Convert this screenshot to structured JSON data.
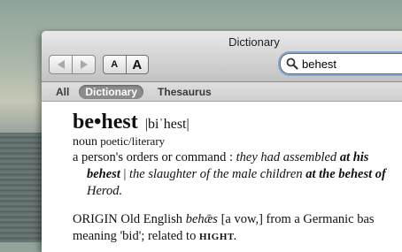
{
  "window": {
    "title": "Dictionary"
  },
  "toolbar": {
    "back_icon": "back-arrow-icon",
    "forward_icon": "forward-arrow-icon",
    "font_smaller_label": "A",
    "font_larger_label": "A"
  },
  "search": {
    "value": "behest",
    "icon": "magnifier-icon"
  },
  "tabs": [
    {
      "label": "All",
      "active": false
    },
    {
      "label": "Dictionary",
      "active": true
    },
    {
      "label": "Thesaurus",
      "active": false
    }
  ],
  "entry": {
    "headword": "be•hest",
    "pronunciation": "|biˈhest|",
    "pos": "noun",
    "register": "poetic/literary",
    "definition": {
      "text": "a person's orders or command : ",
      "ex1a": "they had assembled ",
      "ex1b": "at his",
      "ex1c": "behest",
      "sep": " | ",
      "ex2a": "the slaughter of the male children ",
      "ex2b": "at the behest of",
      "ex2c": "Herod."
    },
    "origin": {
      "label": "ORIGIN",
      "text1": " Old English ",
      "etym": "behǣs",
      "text2": " [a vow,] from a Germanic bas",
      "text3": "meaning ",
      "bid": "'bid'",
      "text4": "; related to ",
      "hight": "HIGHT."
    }
  },
  "colors": {
    "focus_ring": "#7fa8d9",
    "active_tab": "#8c8c8c"
  }
}
